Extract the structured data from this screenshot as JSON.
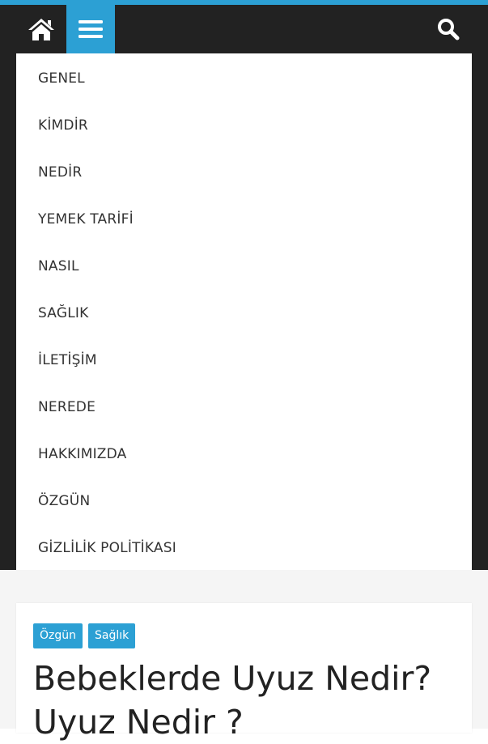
{
  "header": {
    "home_icon": "home-icon",
    "menu_icon": "hamburger-menu-icon",
    "search_icon": "search-icon",
    "colors": {
      "accent": "#2ca0d4",
      "bar": "#222222"
    }
  },
  "menu": {
    "items": [
      {
        "label": "GENEL"
      },
      {
        "label": "KİMDİR"
      },
      {
        "label": "NEDİR"
      },
      {
        "label": "YEMEK TARİFİ"
      },
      {
        "label": "NASIL"
      },
      {
        "label": "SAĞLIK"
      },
      {
        "label": "İLETİŞİM"
      },
      {
        "label": "NEREDE"
      },
      {
        "label": "HAKKIMIZDA"
      },
      {
        "label": "ÖZGÜN"
      },
      {
        "label": "GİZLİLİK POLİTİKASI"
      }
    ]
  },
  "post": {
    "tags": [
      "Özgün",
      "Sağlık"
    ],
    "title": "Bebeklerde Uyuz Nedir? Uyuz Nedir ?"
  }
}
